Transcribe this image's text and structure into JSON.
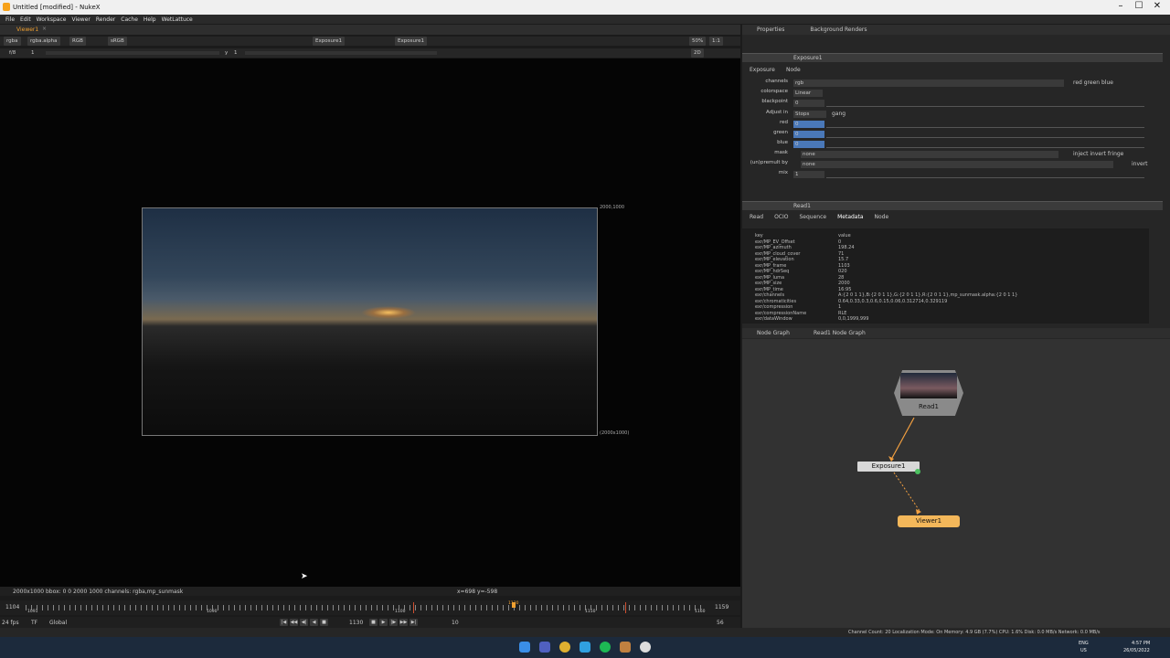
{
  "window": {
    "title": "Untitled [modified] - NukeX",
    "controls": [
      "–",
      "☐",
      "✕"
    ]
  },
  "menu": [
    "File",
    "Edit",
    "Workspace",
    "Viewer",
    "Render",
    "Cache",
    "Help",
    "WetLattuce"
  ],
  "viewer": {
    "tab": "Viewer1",
    "toolbar": {
      "channels": "rgba",
      "alpha": "rgba.alpha",
      "display": "RGB",
      "lut": "sRGB",
      "a_input": "Exposure1",
      "b_input": "Exposure1",
      "zoom": "50%",
      "ratio": "1:1"
    },
    "toolbar2": {
      "fstop": "f/8",
      "frame_step": "1",
      "y_label": "y",
      "y_value": "1",
      "mode": "2D"
    },
    "format_tr": "2000,1000",
    "format_br": "(2000x1000)",
    "info_left": "2000x1000  bbox: 0 0 2000 1000 channels: rgba,mp_sunmask",
    "info_mid": "x=698 y=-598"
  },
  "timeline": {
    "start": "1104",
    "end": "1159",
    "ticks": [
      "1091",
      "1090",
      "1100",
      "1130",
      "1150",
      "1160"
    ],
    "fps": "24 fps",
    "tf": "TF",
    "global": "Global",
    "current": "1130",
    "step": "10",
    "end_field": "56"
  },
  "properties": {
    "tabs": [
      "Properties",
      "Background Renders"
    ],
    "exposure": {
      "name": "Exposure1",
      "tabs": [
        "Exposure",
        "Node"
      ],
      "rows": [
        {
          "label": "channels",
          "value": "rgb",
          "extra": "red  green  blue"
        },
        {
          "label": "colorspace",
          "value": "Linear"
        },
        {
          "label": "blackpoint",
          "value": "0"
        },
        {
          "label": "Adjust in",
          "value": "Stops",
          "extra": "gang"
        },
        {
          "label": "red",
          "value": "0"
        },
        {
          "label": "green",
          "value": "0"
        },
        {
          "label": "blue",
          "value": "0"
        },
        {
          "label": "mask",
          "value": "none",
          "extra": "inject   invert   fringe"
        },
        {
          "label": "(un)premult by",
          "value": "none",
          "extra": "invert"
        },
        {
          "label": "mix",
          "value": "1"
        }
      ]
    },
    "read": {
      "name": "Read1",
      "tabs": [
        "Read",
        "OCIO",
        "Sequence",
        "Metadata",
        "Node"
      ],
      "headers": [
        "key",
        "value"
      ],
      "metadata": [
        [
          "exr/MP_EV_Offset",
          "0"
        ],
        [
          "exr/MP_azimuth",
          "198.24"
        ],
        [
          "exr/MP_cloud_cover",
          "71"
        ],
        [
          "exr/MP_elevation",
          "15.7"
        ],
        [
          "exr/MP_frame",
          "1103"
        ],
        [
          "exr/MP_hdrSeq",
          "020"
        ],
        [
          "exr/MP_luma",
          "28"
        ],
        [
          "exr/MP_size",
          "2000"
        ],
        [
          "exr/MP_time",
          "16:95"
        ],
        [
          "exr/channels",
          "A:{2 0 1 1},B:{2 0 1 1},G:{2 0 1 1},R:{2 0 1 1},mp_sunmask.alpha:{2 0 1 1}"
        ],
        [
          "exr/chromaticities",
          "0.64,0.33,0.3,0.6,0.15,0.06,0.312714,0.329119"
        ],
        [
          "exr/compression",
          "1"
        ],
        [
          "exr/compressionName",
          "RLE"
        ],
        [
          "exr/dataWindow",
          "0,0,1999,999"
        ]
      ]
    }
  },
  "node_graph": {
    "tabs": [
      "Node Graph",
      "Read1 Node Graph"
    ],
    "nodes": [
      "Read1",
      "Exposure1",
      "Viewer1"
    ]
  },
  "status": "Channel Count: 20  Localization Mode: On  Memory: 4.9 GB (7.7%)  CPU: 1.6%  Disk: 0.0 MB/s  Network: 0.0 MB/s",
  "taskbar": {
    "lang": "ENG",
    "region": "US",
    "time": "4:57 PM",
    "date": "26/05/2022"
  },
  "colors": {
    "accent": "#f0a030",
    "viewer_node": "#f3b75a",
    "exposure_node": "#d8d8d8",
    "read_node": "#8a8a8a"
  }
}
